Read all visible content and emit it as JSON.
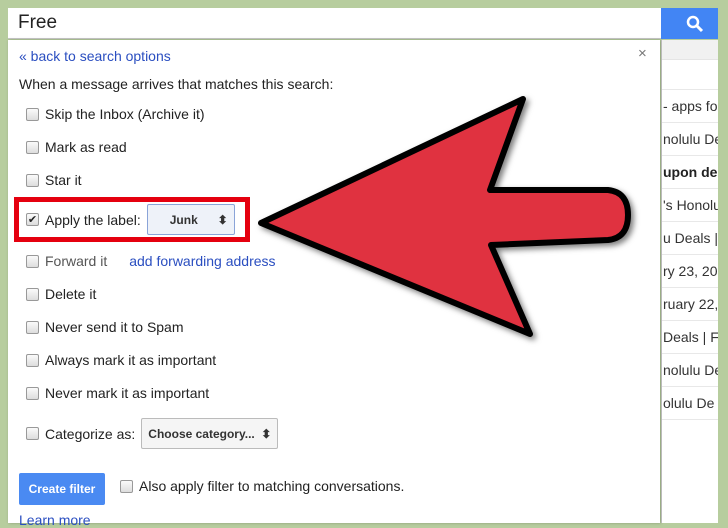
{
  "search": {
    "value": "Free",
    "icon": "search-icon"
  },
  "filter": {
    "back_link": "« back to search options",
    "close": "×",
    "intro": "When a message arrives that matches this search:",
    "options": [
      {
        "label": "Skip the Inbox (Archive it)",
        "checked": false
      },
      {
        "label": "Mark as read",
        "checked": false
      },
      {
        "label": "Star it",
        "checked": false
      },
      {
        "label": "Apply the label:",
        "checked": true,
        "select": "Junk"
      },
      {
        "label": "Forward it",
        "checked": false,
        "link": "add forwarding address"
      },
      {
        "label": "Delete it",
        "checked": false
      },
      {
        "label": "Never send it to Spam",
        "checked": false
      },
      {
        "label": "Always mark it as important",
        "checked": false
      },
      {
        "label": "Never mark it as important",
        "checked": false
      },
      {
        "label": "Categorize as:",
        "checked": false,
        "select": "Choose category..."
      }
    ],
    "create_button": "Create filter",
    "also_apply": "Also apply filter to matching conversations.",
    "learn_more": "Learn more"
  },
  "list_rows": [
    "- apps for",
    "nolulu De",
    "upon de",
    "'s Honolu",
    "u Deals |",
    "ry 23, 20",
    "ruary 22,",
    "Deals | F",
    "nolulu De",
    "olulu De"
  ],
  "colors": {
    "background": "#b7cd9e",
    "accent": "#4285f4",
    "highlight": "#e5000f",
    "arrow": "#e03040"
  }
}
